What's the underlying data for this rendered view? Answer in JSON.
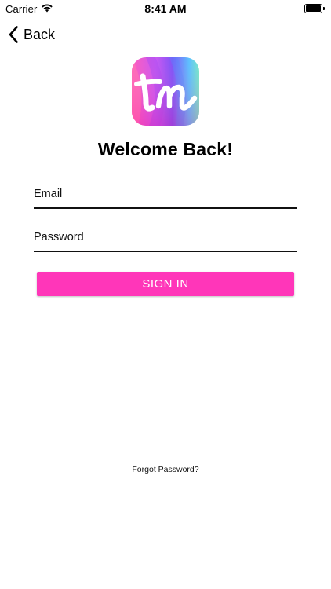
{
  "status_bar": {
    "carrier": "Carrier",
    "time": "8:41 AM",
    "wifi_icon": "wifi-icon",
    "battery_icon": "battery-icon",
    "battery_level": 1.0
  },
  "nav": {
    "back_label": "Back",
    "back_icon": "chevron-left-icon"
  },
  "logo": {
    "icon": "app-logo",
    "text": "tm",
    "colors": [
      "#7b2ff7",
      "#ff3fb0",
      "#3fd0ff",
      "#5ee6c0"
    ]
  },
  "title": "Welcome Back!",
  "form": {
    "email_placeholder": "Email",
    "email_value": "",
    "password_placeholder": "Password",
    "password_value": "",
    "submit_label": "SIGN IN"
  },
  "forgot_password_label": "Forgot Password?",
  "colors": {
    "accent": "#ff36b9",
    "text": "#000000",
    "background": "#ffffff"
  }
}
